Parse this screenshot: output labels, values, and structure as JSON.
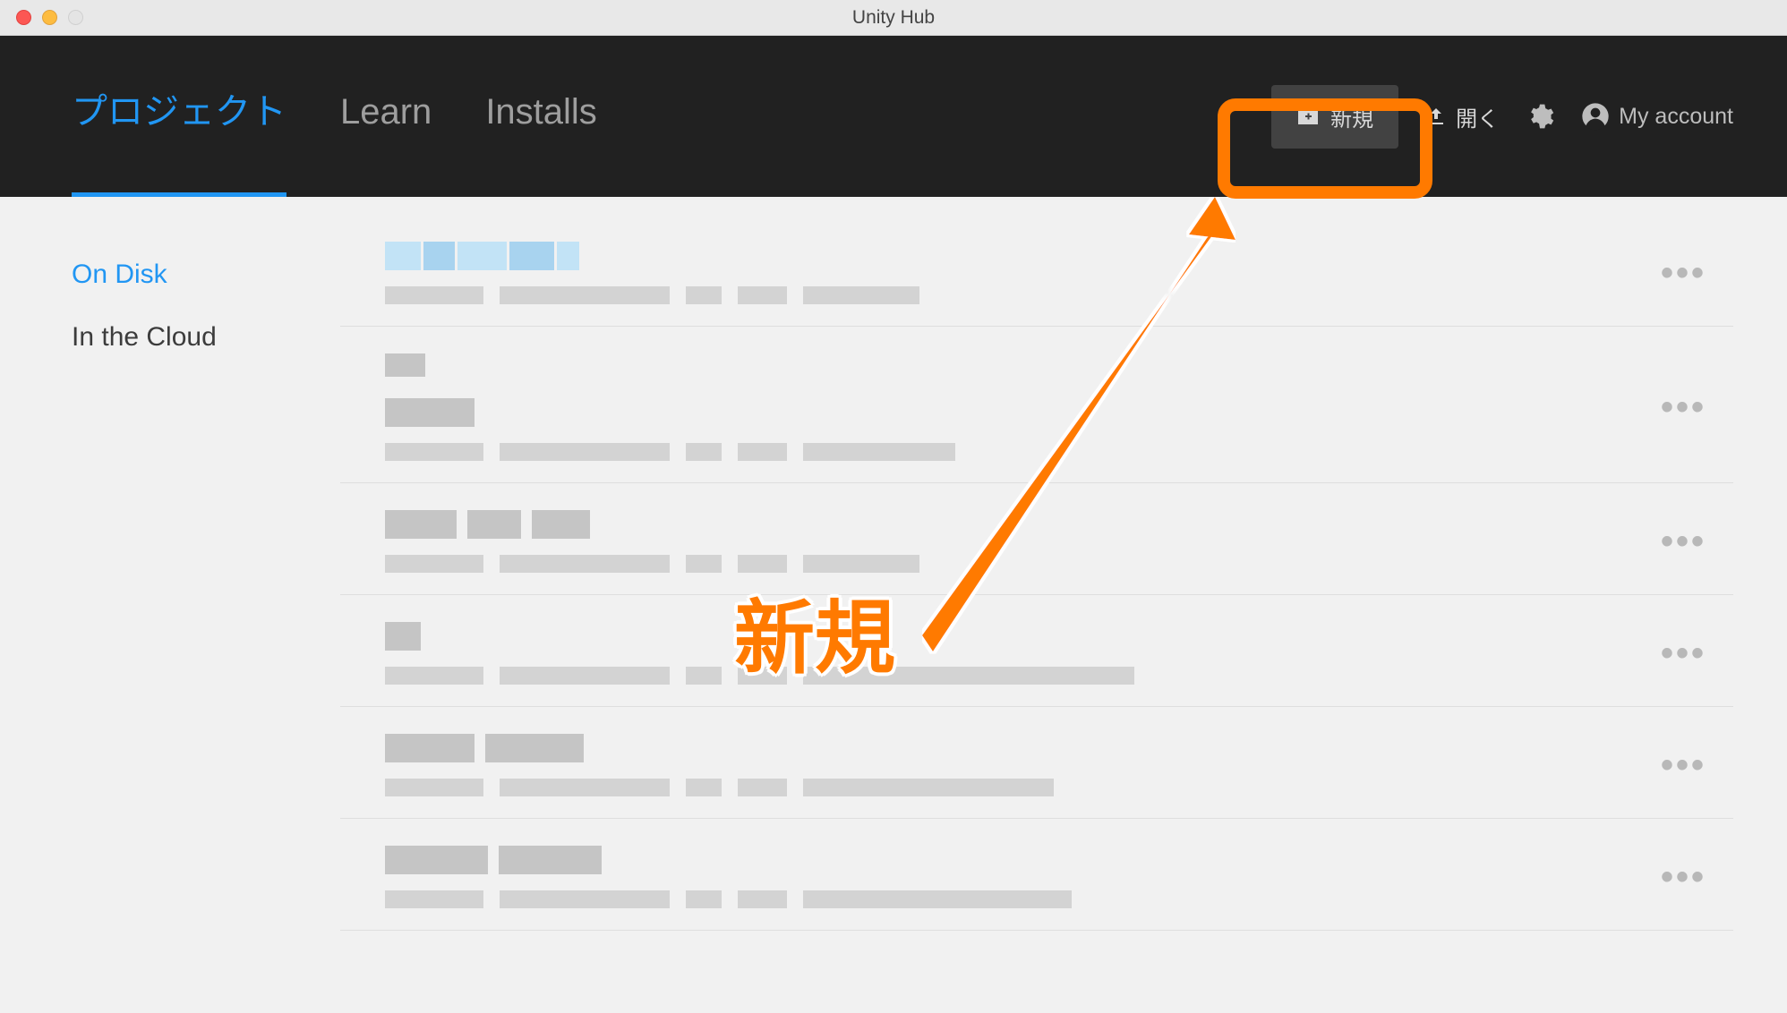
{
  "window": {
    "title": "Unity Hub"
  },
  "tabs": [
    {
      "label": "プロジェクト",
      "active": true
    },
    {
      "label": "Learn",
      "active": false
    },
    {
      "label": "Installs",
      "active": false
    }
  ],
  "actions": {
    "new_label": "新規",
    "open_label": "開く",
    "account_label": "My account"
  },
  "sidebar": {
    "items": [
      {
        "label": "On Disk",
        "active": true
      },
      {
        "label": "In the Cloud",
        "active": false
      }
    ]
  },
  "projects_count": 6,
  "annotation": {
    "label": "新規"
  }
}
